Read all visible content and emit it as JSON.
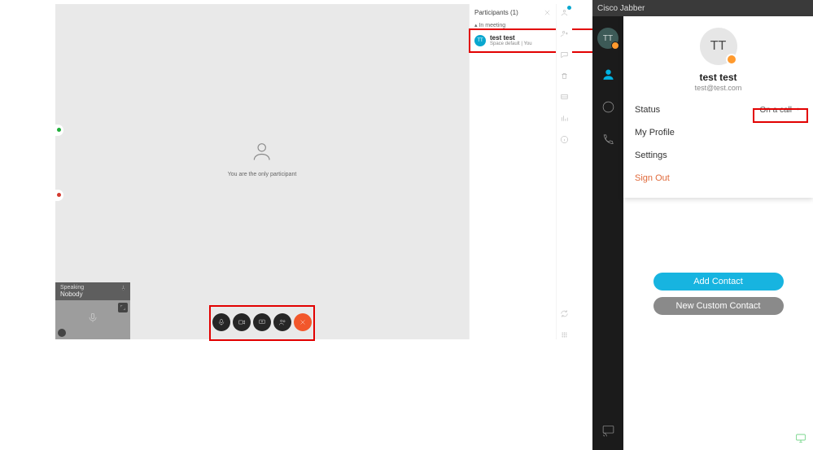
{
  "meeting": {
    "center_message": "You are the only participant",
    "speaking": {
      "label": "Speaking",
      "value": "Nobody"
    },
    "participants": {
      "title": "Participants (1)",
      "section": "In meeting",
      "items": [
        {
          "initials": "TT",
          "name": "test test",
          "sub": "Space default | You"
        }
      ]
    },
    "controls": [
      "mic",
      "camera",
      "share",
      "participants",
      "end"
    ]
  },
  "jabber": {
    "title": "Cisco Jabber",
    "avatar_initials": "TT",
    "popover": {
      "initials": "TT",
      "name": "test test",
      "email": "test@test.com",
      "rows": {
        "status_label": "Status",
        "status_value": "On a call",
        "profile": "My Profile",
        "settings": "Settings",
        "signout": "Sign Out"
      }
    },
    "buttons": {
      "add": "Add Contact",
      "custom": "New Custom Contact"
    }
  }
}
